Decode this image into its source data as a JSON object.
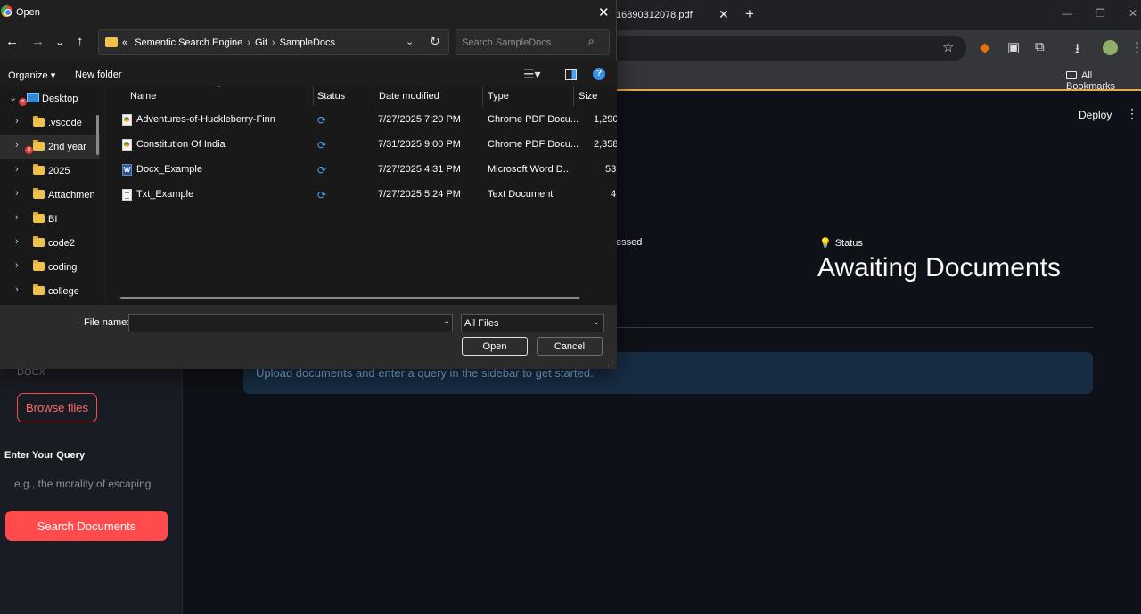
{
  "browser": {
    "tab_title": "16890312078.pdf",
    "tab_close": "✕",
    "new_tab": "+",
    "bookmarks_label": "All Bookmarks"
  },
  "app": {
    "sidebar": {
      "file_types_hint": "DOCX",
      "browse_label": "Browse files",
      "query_label": "Enter Your Query",
      "query_placeholder": "e.g., the morality of escaping",
      "search_label": "Search Documents"
    },
    "header": {
      "deploy_label": "Deploy"
    },
    "metrics": {
      "processed_fragment": "essed",
      "status_label": "Status",
      "status_value": "Awaiting Documents"
    },
    "info_message": "Upload documents and enter a query in the sidebar to get started."
  },
  "dialog": {
    "title": "Open",
    "address": {
      "overflow": "«",
      "segments": [
        "Sementic Search Engine",
        "Git",
        "SampleDocs"
      ],
      "separator": "›"
    },
    "search_placeholder": "Search SampleDocs",
    "commands": {
      "organize": "Organize ▾",
      "new_folder": "New folder"
    },
    "nav": [
      {
        "label": "Desktop",
        "kind": "desktop"
      },
      {
        "label": ".vscode",
        "kind": "folder"
      },
      {
        "label": "2nd year",
        "kind": "folder"
      },
      {
        "label": "2025",
        "kind": "folder"
      },
      {
        "label": "Attachmen",
        "kind": "folder"
      },
      {
        "label": "BI",
        "kind": "folder"
      },
      {
        "label": "code2",
        "kind": "folder"
      },
      {
        "label": "coding",
        "kind": "folder"
      },
      {
        "label": "college",
        "kind": "folder"
      }
    ],
    "columns": [
      "Name",
      "Status",
      "Date modified",
      "Type",
      "Size"
    ],
    "files": [
      {
        "name": "Adventures-of-Huckleberry-Finn",
        "icon": "pdf",
        "status": "sync-icon",
        "date": "7/27/2025 7:20 PM",
        "type": "Chrome PDF Docu...",
        "size": "1,290"
      },
      {
        "name": "Constitution Of India",
        "icon": "pdf",
        "status": "sync-icon",
        "date": "7/31/2025 9:00 PM",
        "type": "Chrome PDF Docu...",
        "size": "2,358"
      },
      {
        "name": "Docx_Example",
        "icon": "word",
        "status": "sync-icon",
        "date": "7/27/2025 4:31 PM",
        "type": "Microsoft Word D...",
        "size": "53"
      },
      {
        "name": "Txt_Example",
        "icon": "txt",
        "status": "sync-icon",
        "date": "7/27/2025 5:24 PM",
        "type": "Text Document",
        "size": "4"
      }
    ],
    "file_name_label": "File name:",
    "file_name_value": "",
    "filter_value": "All Files",
    "open_label": "Open",
    "cancel_label": "Cancel"
  },
  "colors": {
    "accent": "#ff4b4b",
    "dialog_bg": "#202020",
    "app_bg": "#0e1117",
    "info_bg": "#172d43",
    "folder": "#f0c24b"
  }
}
